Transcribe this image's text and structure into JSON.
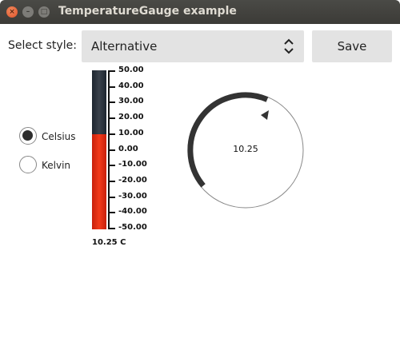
{
  "window": {
    "title": "TemperatureGauge example",
    "buttons": {
      "close": "×",
      "minimize": "–",
      "maximize": "□"
    }
  },
  "controls": {
    "style_label": "Select style:",
    "style_value": "Alternative",
    "save_label": "Save"
  },
  "units": {
    "options": [
      {
        "label": "Celsius",
        "checked": true
      },
      {
        "label": "Kelvin",
        "checked": false
      }
    ]
  },
  "thermometer": {
    "scale_labels": [
      "50.00",
      "40.00",
      "30.00",
      "20.00",
      "10.00",
      "0.00",
      "-10.00",
      "-20.00",
      "-30.00",
      "-40.00",
      "-50.00"
    ],
    "min": -50,
    "max": 50,
    "level": 10,
    "readout": "10.25 C",
    "colors": {
      "hot": "#f23a1a",
      "cold": "#2c343e"
    }
  },
  "gauge": {
    "value_text": "10.25",
    "value": 10.25,
    "colors": {
      "arc": "#333333",
      "ring": "#888888"
    }
  }
}
